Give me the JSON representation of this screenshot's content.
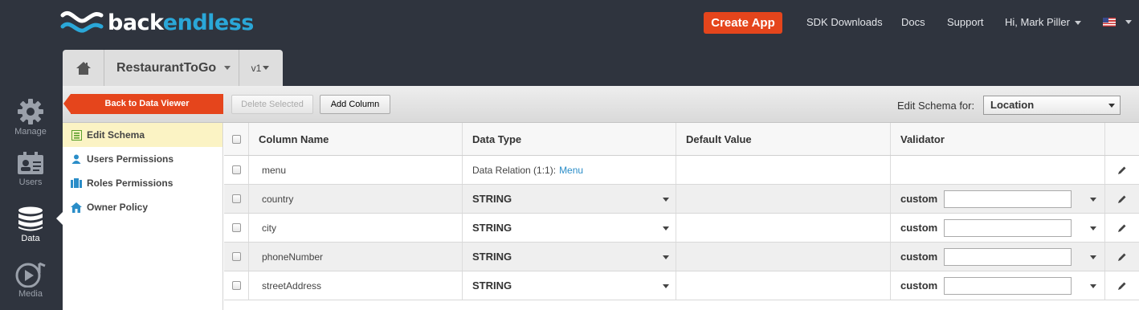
{
  "brand": {
    "logo_prefix": "back",
    "logo_suffix": "endless"
  },
  "topnav": {
    "create_app": "Create App",
    "sdk": "SDK Downloads",
    "docs": "Docs",
    "support": "Support",
    "user": "Hi, Mark Piller"
  },
  "rail": [
    {
      "label": "Manage",
      "icon": "gear-icon"
    },
    {
      "label": "Users",
      "icon": "id-card-icon"
    },
    {
      "label": "Data",
      "icon": "database-icon"
    },
    {
      "label": "Media",
      "icon": "media-icon"
    }
  ],
  "apptab": {
    "app_name": "RestaurantToGo",
    "version": "v1"
  },
  "toolbar": {
    "back": "Back to Data Viewer",
    "delete": "Delete Selected",
    "add": "Add Column",
    "schema_label": "Edit Schema for:",
    "schema_value": "Location"
  },
  "side": [
    {
      "label": "Edit Schema",
      "icon": "schema-icon"
    },
    {
      "label": "Users Permissions",
      "icon": "user-icon"
    },
    {
      "label": "Roles Permissions",
      "icon": "roles-icon"
    },
    {
      "label": "Owner Policy",
      "icon": "home-icon"
    }
  ],
  "table": {
    "headers": {
      "name": "Column Name",
      "type": "Data Type",
      "default": "Default Value",
      "validator": "Validator"
    },
    "rows": [
      {
        "name": "menu",
        "type_prefix": "Data Relation (1:1):",
        "type_link": "Menu"
      },
      {
        "name": "country",
        "type": "STRING",
        "validator": "custom"
      },
      {
        "name": "city",
        "type": "STRING",
        "validator": "custom"
      },
      {
        "name": "phoneNumber",
        "type": "STRING",
        "validator": "custom"
      },
      {
        "name": "streetAddress",
        "type": "STRING",
        "validator": "custom"
      }
    ]
  },
  "colors": {
    "accent": "#e5451c",
    "brand_blue": "#2aa7d8",
    "bg_dark": "#2f343e",
    "active_row": "#fbf3c4"
  }
}
